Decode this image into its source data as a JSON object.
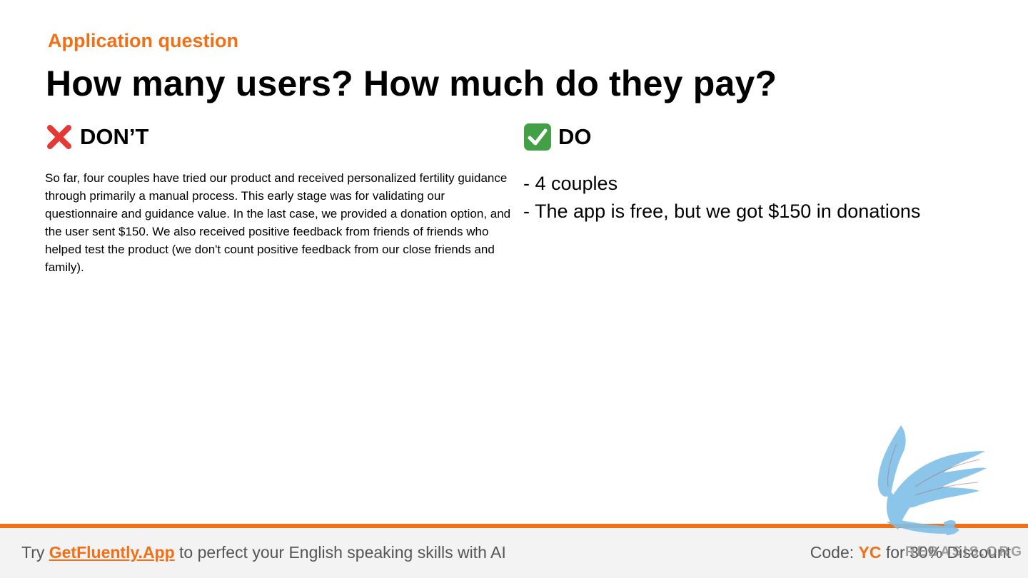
{
  "slide": {
    "eyebrow": "Application question",
    "title": "How many users? How much do they pay?"
  },
  "dont": {
    "icon": "cross-mark-icon",
    "heading": "DON’T",
    "text": "So far, four couples have tried our product and received personalized fertility guidance through primarily a manual process. This early stage was for validating our questionnaire and guidance value. In the last case, we provided a donation option, and the user sent $150. We also received positive feedback from friends of friends who helped test the product (we don't count positive feedback from our close friends and family)."
  },
  "do": {
    "icon": "check-mark-icon",
    "heading": "DO",
    "items": [
      "- 4 couples",
      "- The app is free, but we got $150 in donations"
    ]
  },
  "footer": {
    "prefix": "Try ",
    "link_text": "GetFluently.App",
    "suffix": " to perfect your English speaking skills with AI",
    "code_prefix": "Code: ",
    "code": "YC",
    "code_suffix": " for 30% Discount"
  },
  "watermark": {
    "text": "REBASIS.ORG"
  },
  "colors": {
    "accent": "#f07017",
    "cross": "#e53935",
    "check": "#43a047",
    "footer_bg": "#f3f3f3",
    "footer_text": "#555555",
    "watermark": "#7fc0e8"
  }
}
